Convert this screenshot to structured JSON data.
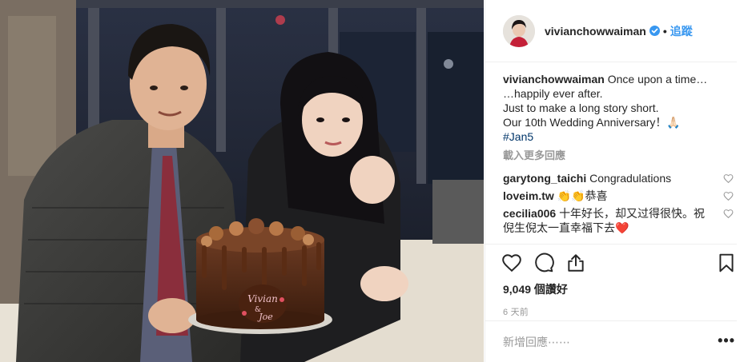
{
  "post": {
    "username": "vivianchowwaiman",
    "verified": true,
    "follow_label": "追蹤",
    "caption_lines": [
      "Once upon a time…",
      "…happily ever after.",
      "Just to make a long story short.",
      "Our 10th Wedding Anniversary！🙏🏻"
    ],
    "hashtag": "#Jan5",
    "load_more_label": "載入更多回應",
    "comments": [
      {
        "user": "garytong_taichi",
        "text": "Congradulations"
      },
      {
        "user": "loveim.tw",
        "text": "👏👏恭喜"
      },
      {
        "user": "cecilia006",
        "text": "十年好长，却又过得很快。祝倪生倪太一直幸福下去❤️"
      }
    ],
    "likes": "9,049 個讚好",
    "time_ago": "6 天前",
    "add_comment_placeholder": "新增回應⋯⋯",
    "more_options": "•••",
    "photo_cake_text": [
      "Vivian",
      "&",
      "Joe"
    ]
  },
  "icons": {
    "like": "heart-icon",
    "comment": "comment-icon",
    "share": "share-icon",
    "save": "bookmark-icon",
    "verified": "verified-badge-icon",
    "comment_like": "heart-small-icon"
  },
  "colors": {
    "link_blue": "#3897f0",
    "hashtag": "#003569",
    "muted": "#999999",
    "border": "#efefef",
    "text": "#262626"
  }
}
